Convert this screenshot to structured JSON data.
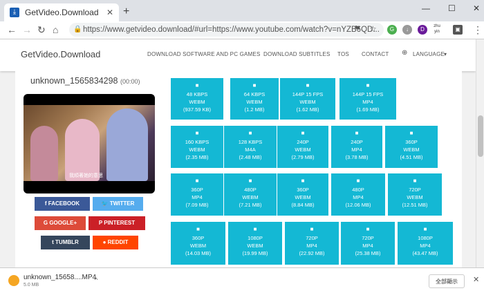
{
  "browser": {
    "tab_title": "GetVideo.Download",
    "tab_close": "✕",
    "new_tab": "+",
    "url": "https://www.getvideo.download/#url=https://www.youtube.com/watch?v=nYZB6QD...",
    "ext_zhu": "zhu yin"
  },
  "site": {
    "brand": "GetVideo.Download",
    "nav": [
      "DOWNLOAD SOFTWARE AND PC GAMES",
      "DOWNLOAD SUBTITLES",
      "TOS",
      "CONTACT",
      "LANGUAGE"
    ]
  },
  "video": {
    "title": "unknown_1565834298",
    "duration": "(00:00)",
    "subtitle": "我順著她的意思"
  },
  "share": {
    "facebook": "FACEBOOK",
    "twitter": "TWITTER",
    "google": "GOOGLE+",
    "pinterest": "PINTEREST",
    "tumblr": "TUMBLR",
    "reddit": "REDDIT"
  },
  "formats": [
    [
      "48 KBPS",
      "WEBM",
      "(937.59 KB)"
    ],
    [
      "64 KBPS",
      "WEBM",
      "(1.2 MB)"
    ],
    [
      "144P 15 FPS",
      "WEBM",
      "(1.62 MB)"
    ],
    [
      "144P 15 FPS",
      "MP4",
      "(1.69 MB)"
    ],
    [
      "160 KBPS",
      "WEBM",
      "(2.35 MB)"
    ],
    [
      "128 KBPS",
      "M4A",
      "(2.48 MB)"
    ],
    [
      "240P",
      "WEBM",
      "(2.79 MB)"
    ],
    [
      "240P",
      "MP4",
      "(3.78 MB)"
    ],
    [
      "360P",
      "WEBM",
      "(4.51 MB)"
    ],
    [
      "360P",
      "MP4",
      "(7.09 MB)"
    ],
    [
      "480P",
      "WEBM",
      "(7.21 MB)"
    ],
    [
      "360P",
      "WEBM",
      "(8.84 MB)"
    ],
    [
      "480P",
      "MP4",
      "(12.06 MB)"
    ],
    [
      "720P",
      "WEBM",
      "(12.51 MB)"
    ],
    [
      "360P",
      "WEBM",
      "(14.03 MB)"
    ],
    [
      "1080P",
      "WEBM",
      "(19.99 MB)"
    ],
    [
      "720P",
      "MP4",
      "(22.92 MB)"
    ],
    [
      "720P",
      "MP4",
      "(25.38 MB)"
    ],
    [
      "1080P",
      "MP4",
      "(43.47 MB)"
    ]
  ],
  "download_bar": {
    "file_name": "unknown_15658....MP4",
    "file_size": "5.0 MB",
    "show_all": "全部顯示"
  },
  "colors": {
    "tile": "#14b8d4",
    "facebook": "#3b5998",
    "twitter": "#55acee",
    "google": "#dd4b39",
    "pinterest": "#cb2027",
    "tumblr": "#35465c",
    "reddit": "#ff4500"
  }
}
